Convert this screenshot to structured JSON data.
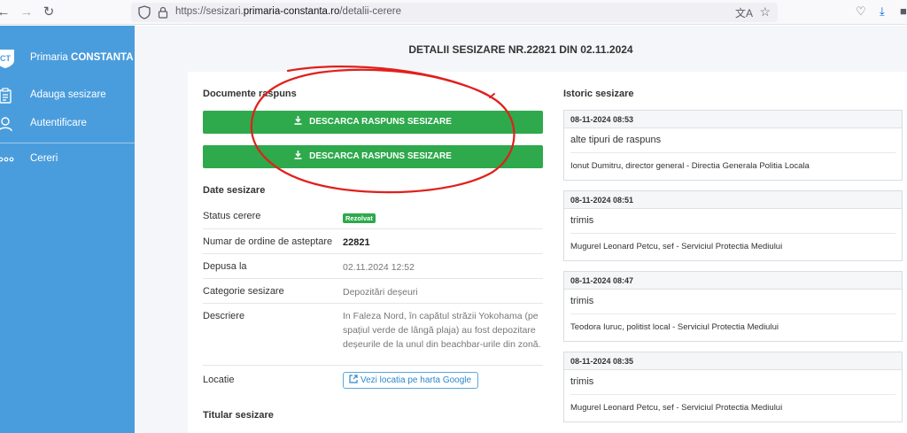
{
  "browser": {
    "url_prefix": "https://sesizari.",
    "url_domain": "primaria-constanta.ro",
    "url_path": "/detalii-cerere"
  },
  "sidebar": {
    "brand_prefix": "Primaria",
    "brand_name": "CONSTANTA",
    "items": [
      {
        "label": "Adauga sesizare",
        "icon": "clipboard-icon"
      },
      {
        "label": "Autentificare",
        "icon": "user-icon"
      },
      {
        "label": "Cereri",
        "icon": "dots-icon"
      }
    ]
  },
  "page": {
    "title": "DETALII SESIZARE NR.22821 DIN 02.11.2024"
  },
  "documents": {
    "title": "Documente raspuns",
    "buttons": [
      "DESCARCA RASPUNS SESIZARE",
      "DESCARCA RASPUNS SESIZARE"
    ]
  },
  "details": {
    "title": "Date sesizare",
    "status_label": "Status cerere",
    "status_value": "Rezolvat",
    "queue_label": "Numar de ordine de asteptare",
    "queue_value": "22821",
    "date_label": "Depusa la",
    "date_value": "02.11.2024 12:52",
    "category_label": "Categorie sesizare",
    "category_value": "Depozitări deșeuri",
    "description_label": "Descriere",
    "description_value": "In Faleza Nord, în capătul străzii Yokohama (pe spațiul verde de lângă plaja) au fost depozitare deșeurile de la unul din beachbar-urile din zonă.",
    "location_label": "Locatie",
    "location_link": "Vezi locatia pe harta Google"
  },
  "owner": {
    "title": "Titular sesizare"
  },
  "history": {
    "title": "Istoric sesizare",
    "entries": [
      {
        "time": "08-11-2024 08:53",
        "status": "alte tipuri de raspuns",
        "by": "Ionut Dumitru, director general - Directia Generala Politia Locala"
      },
      {
        "time": "08-11-2024 08:51",
        "status": "trimis",
        "by": "Mugurel Leonard Petcu, sef - Serviciul Protectia Mediului"
      },
      {
        "time": "08-11-2024 08:47",
        "status": "trimis",
        "by": "Teodora Iuruc, politist local - Serviciul Protectia Mediului"
      },
      {
        "time": "08-11-2024 08:35",
        "status": "trimis",
        "by": "Mugurel Leonard Petcu, sef - Serviciul Protectia Mediului"
      }
    ]
  },
  "colors": {
    "sidebar": "#4a9ddd",
    "button_green": "#2ea94c",
    "annotation_red": "#e0201c"
  }
}
